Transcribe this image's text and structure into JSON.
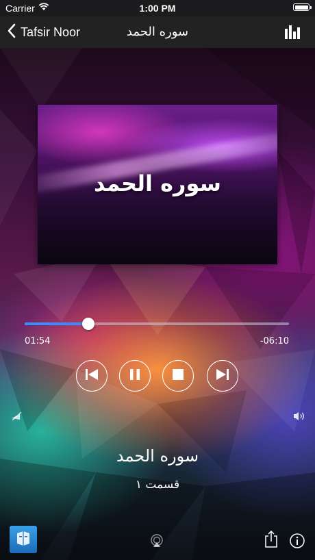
{
  "status_bar": {
    "carrier": "Carrier",
    "time": "1:00 PM"
  },
  "nav": {
    "back_label": "Tafsir Noor",
    "title": "سوره الحمد",
    "icons": [
      "chevron-left-icon",
      "equalizer-icon"
    ]
  },
  "artwork": {
    "title": "سوره الحمد"
  },
  "player": {
    "elapsed": "01:54",
    "remaining": "-06:10",
    "progress": 0.24,
    "accent_color": "#3a8cff",
    "controls": [
      "previous-icon",
      "pause-icon",
      "stop-icon",
      "next-icon"
    ]
  },
  "track": {
    "title": "سوره الحمد",
    "subtitle": "قسمت ۱"
  },
  "bottom_bar": {
    "icons": [
      "book-icon",
      "airplay-icon",
      "share-icon",
      "info-icon"
    ]
  }
}
